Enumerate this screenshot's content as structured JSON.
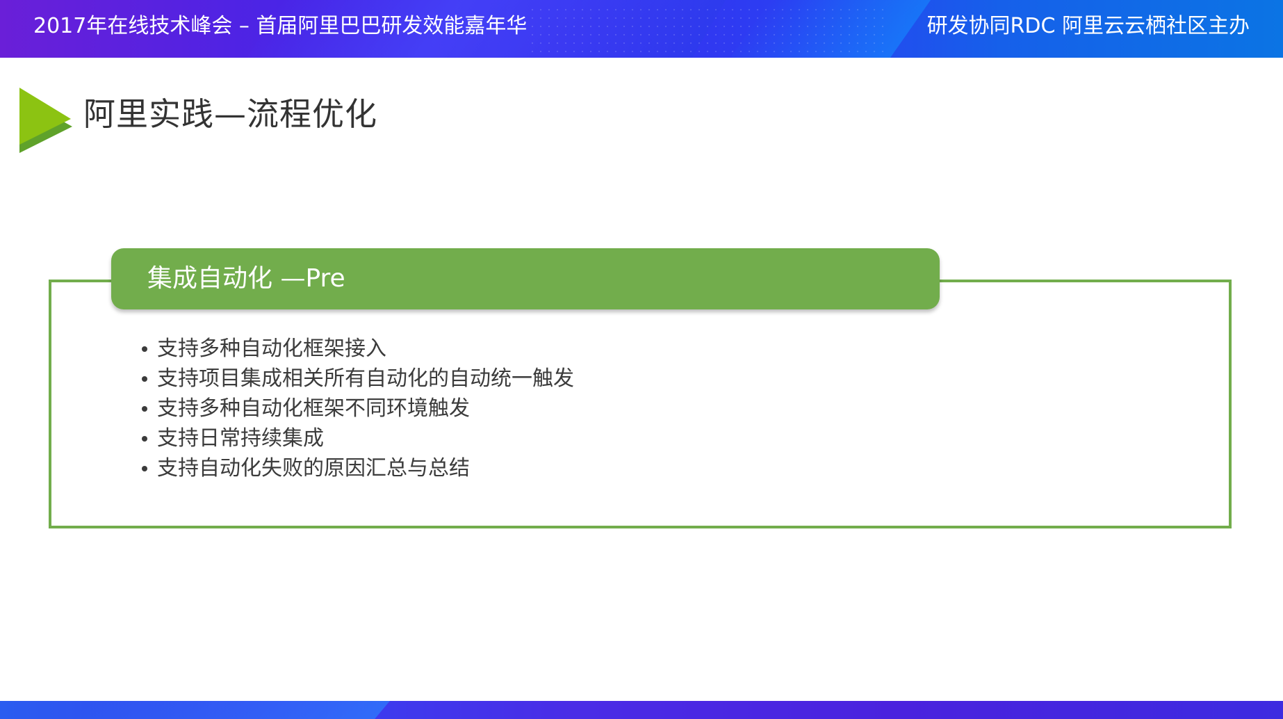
{
  "header": {
    "left_text": "2017年在线技术峰会 – 首届阿里巴巴研发效能嘉年华",
    "right_text": "研发协同RDC 阿里云云栖社区主办"
  },
  "title": {
    "text": "阿里实践—流程优化",
    "icon": "play-triangle-icon"
  },
  "section": {
    "header_label": "集成自动化 —Pre",
    "bullets": [
      "支持多种自动化框架接入",
      "支持项目集成相关所有自动化的自动统一触发",
      "支持多种自动化框架不同环境触发",
      "支持日常持续集成",
      "支持自动化失败的原因汇总与总结"
    ]
  },
  "colors": {
    "accent_green": "#72ad4c",
    "arrow_light_green": "#8cc312",
    "arrow_dark_green": "#5fa22a",
    "banner_purple": "#6a1fd8",
    "banner_blue": "#0b74e4",
    "text_dark": "#333333"
  }
}
